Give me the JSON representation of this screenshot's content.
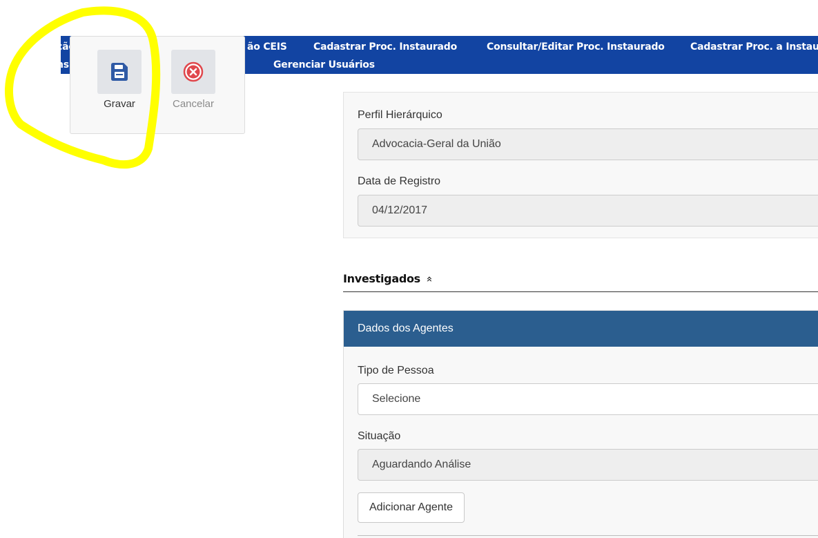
{
  "nav": {
    "row1": [
      "ção",
      "ão CEIS",
      "Cadastrar Proc. Instaurado",
      "Consultar/Editar Proc. Instaurado",
      "Cadastrar Proc. a Instau"
    ],
    "row2": [
      "ns",
      "Gerenciar Usuários"
    ]
  },
  "toolbar": {
    "save_label": "Gravar",
    "cancel_label": "Cancelar",
    "save_icon": "floppy-disk-icon",
    "cancel_icon": "close-circle-icon"
  },
  "form": {
    "perfil_label": "Perfil Hierárquico",
    "perfil_value": "Advocacia-Geral da União",
    "data_label": "Data de Registro",
    "data_value": "04/12/2017"
  },
  "section": {
    "title": "Investigados",
    "chevron": "«"
  },
  "agents": {
    "header": "Dados dos Agentes",
    "tipo_label": "Tipo de Pessoa",
    "tipo_value": "Selecione",
    "situacao_label": "Situação",
    "situacao_value": "Aguardando Análise",
    "add_button": "Adicionar Agente"
  },
  "colors": {
    "nav_bg": "#1244a2",
    "save_icon": "#2f5aa5",
    "cancel_icon": "#e0474c",
    "agents_header": "#2b5e8f",
    "highlight": "#ffff00"
  }
}
